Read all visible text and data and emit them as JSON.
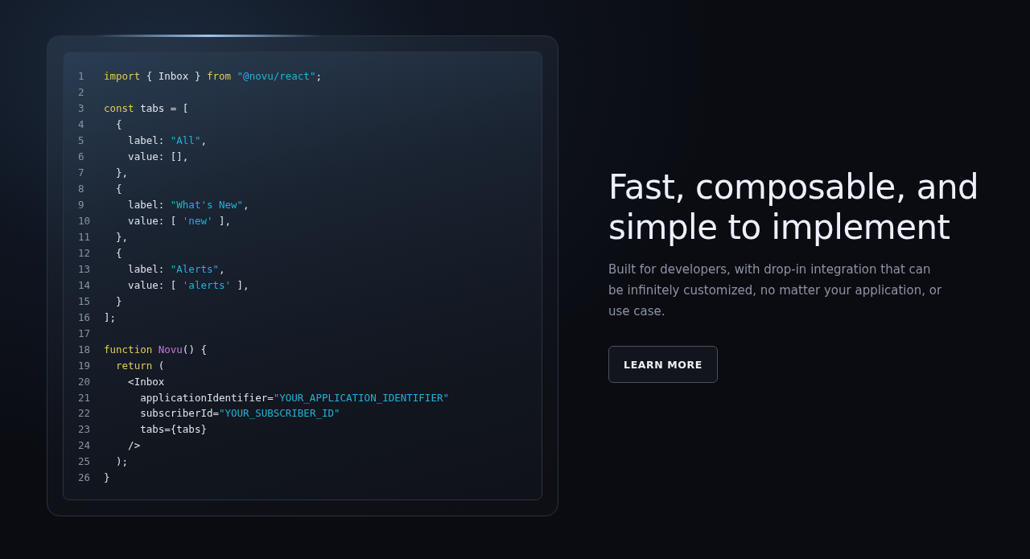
{
  "code": {
    "lines": [
      {
        "number": "1",
        "tokens": [
          {
            "kind": "keyword",
            "text": "import"
          },
          {
            "kind": "plain",
            "text": " { Inbox } "
          },
          {
            "kind": "keyword",
            "text": "from"
          },
          {
            "kind": "string",
            "text": " \"@novu/react\""
          },
          {
            "kind": "plain",
            "text": ";"
          }
        ]
      },
      {
        "number": "2"
      },
      {
        "number": "3",
        "tokens": [
          {
            "kind": "keyword",
            "text": "const"
          },
          {
            "kind": "plain",
            "text": " tabs = ["
          }
        ]
      },
      {
        "number": "4",
        "tokens": [
          {
            "kind": "plain",
            "text": "  {"
          }
        ]
      },
      {
        "number": "5",
        "tokens": [
          {
            "kind": "plain",
            "text": "    label: "
          },
          {
            "kind": "string",
            "text": "\"All\""
          },
          {
            "kind": "plain",
            "text": ","
          }
        ]
      },
      {
        "number": "6",
        "tokens": [
          {
            "kind": "plain",
            "text": "    value: [],"
          }
        ]
      },
      {
        "number": "7",
        "tokens": [
          {
            "kind": "plain",
            "text": "  },"
          }
        ]
      },
      {
        "number": "8",
        "tokens": [
          {
            "kind": "plain",
            "text": "  {"
          }
        ]
      },
      {
        "number": "9",
        "tokens": [
          {
            "kind": "plain",
            "text": "    label: "
          },
          {
            "kind": "string",
            "text": "\"What's New\""
          },
          {
            "kind": "plain",
            "text": ","
          }
        ]
      },
      {
        "number": "10",
        "tokens": [
          {
            "kind": "plain",
            "text": "    value: [ "
          },
          {
            "kind": "string",
            "text": "'new'"
          },
          {
            "kind": "plain",
            "text": " ],"
          }
        ]
      },
      {
        "number": "11",
        "tokens": [
          {
            "kind": "plain",
            "text": "  },"
          }
        ]
      },
      {
        "number": "12",
        "tokens": [
          {
            "kind": "plain",
            "text": "  {"
          }
        ]
      },
      {
        "number": "13",
        "tokens": [
          {
            "kind": "plain",
            "text": "    label: "
          },
          {
            "kind": "string",
            "text": "\"Alerts\""
          },
          {
            "kind": "plain",
            "text": ","
          }
        ]
      },
      {
        "number": "14",
        "tokens": [
          {
            "kind": "plain",
            "text": "    value: [ "
          },
          {
            "kind": "string",
            "text": "'alerts'"
          },
          {
            "kind": "plain",
            "text": " ],"
          }
        ]
      },
      {
        "number": "15",
        "tokens": [
          {
            "kind": "plain",
            "text": "  }"
          }
        ]
      },
      {
        "number": "16",
        "tokens": [
          {
            "kind": "plain",
            "text": "];"
          }
        ]
      },
      {
        "number": "17"
      },
      {
        "number": "18",
        "tokens": [
          {
            "kind": "keyword",
            "text": "function"
          },
          {
            "kind": "function",
            "text": " Novu"
          },
          {
            "kind": "plain",
            "text": "() {"
          }
        ]
      },
      {
        "number": "19",
        "tokens": [
          {
            "kind": "keyword",
            "text": "  return"
          },
          {
            "kind": "plain",
            "text": " ("
          }
        ]
      },
      {
        "number": "20",
        "tokens": [
          {
            "kind": "plain",
            "text": "    <Inbox"
          }
        ]
      },
      {
        "number": "21",
        "tokens": [
          {
            "kind": "plain",
            "text": "      applicationIdentifier="
          },
          {
            "kind": "string",
            "text": "\"YOUR_APPLICATION_IDENTIFIER\""
          }
        ]
      },
      {
        "number": "22",
        "tokens": [
          {
            "kind": "plain",
            "text": "      subscriberId="
          },
          {
            "kind": "string",
            "text": "\"YOUR_SUBSCRIBER_ID\""
          }
        ]
      },
      {
        "number": "23",
        "tokens": [
          {
            "kind": "plain",
            "text": "      tabs={tabs}"
          }
        ]
      },
      {
        "number": "24",
        "tokens": [
          {
            "kind": "plain",
            "text": "    />"
          }
        ]
      },
      {
        "number": "25",
        "tokens": [
          {
            "kind": "plain",
            "text": "  );"
          }
        ]
      },
      {
        "number": "26",
        "tokens": [
          {
            "kind": "plain",
            "text": "}"
          }
        ]
      }
    ]
  },
  "heading": "Fast, composable, and simple to implement",
  "description": "Built for developers, with drop-in integration that can be infinitely customized, no matter your application, or use case.",
  "button": "LEARN MORE"
}
